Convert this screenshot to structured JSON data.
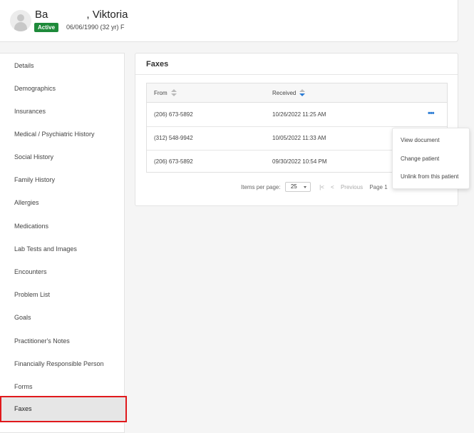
{
  "patient": {
    "name_prefix": "Ba",
    "name_suffix": ", Viktoria",
    "status": "Active",
    "dob_info": "06/06/1990 (32 yr) F"
  },
  "sidebar": {
    "items": [
      {
        "label": "Details"
      },
      {
        "label": "Demographics"
      },
      {
        "label": "Insurances"
      },
      {
        "label": "Medical / Psychiatric History"
      },
      {
        "label": "Social History"
      },
      {
        "label": "Family History"
      },
      {
        "label": "Allergies"
      },
      {
        "label": "Medications"
      },
      {
        "label": "Lab Tests and Images"
      },
      {
        "label": "Encounters"
      },
      {
        "label": "Problem List"
      },
      {
        "label": "Goals"
      },
      {
        "label": "Practitioner's Notes"
      },
      {
        "label": "Financially Responsible Person"
      },
      {
        "label": "Forms"
      },
      {
        "label": "Faxes",
        "active": true
      }
    ]
  },
  "faxes": {
    "title": "Faxes",
    "columns": {
      "from": "From",
      "received": "Received"
    },
    "rows": [
      {
        "from": "(206) 673-5892",
        "received": "10/26/2022 11:25 AM"
      },
      {
        "from": "(312) 548-9942",
        "received": "10/05/2022 11:33 AM"
      },
      {
        "from": "(206) 673-5892",
        "received": "09/30/2022 10:54 PM"
      }
    ],
    "more_glyph": "•••"
  },
  "pager": {
    "items_per_page_label": "Items per page:",
    "items_per_page_value": "25",
    "first_glyph": "|<",
    "prev_glyph": "<",
    "previous_label": "Previous",
    "page_label": "Page 1"
  },
  "row_menu": {
    "items": [
      "View document",
      "Change patient",
      "Unlink from this patient"
    ]
  },
  "colors": {
    "active_badge": "#1e8a3a",
    "accent_blue": "#2a7bd4",
    "active_nav_border": "#e0191c"
  }
}
